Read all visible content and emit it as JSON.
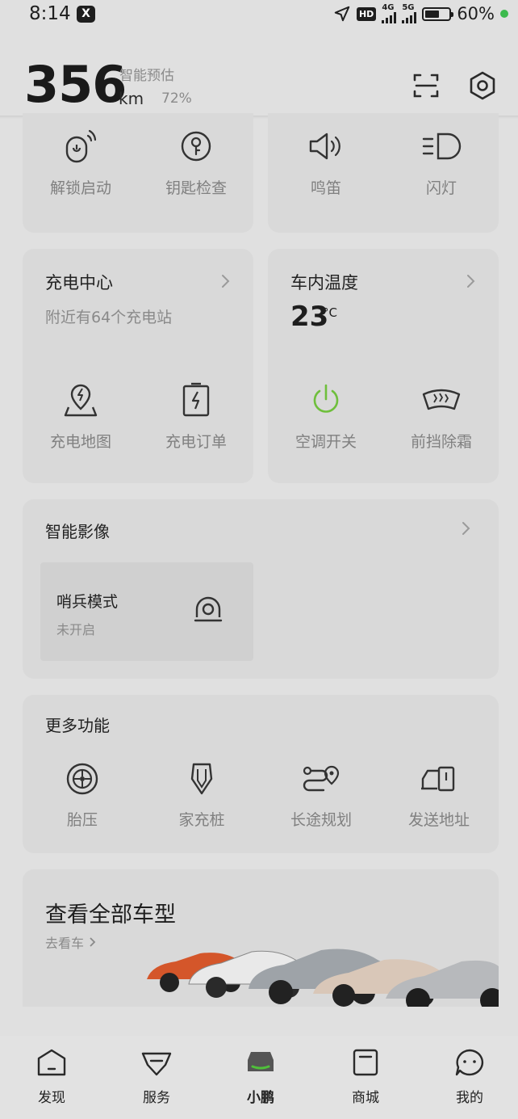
{
  "status_bar": {
    "time": "8:14",
    "app_icon": "X",
    "net_badge": "HD",
    "sim1": "4G",
    "sim2": "5G",
    "battery_level": 0.6,
    "battery_text": "60%"
  },
  "header": {
    "range_value": "356",
    "range_unit": "km",
    "estimate_label": "智能预估",
    "battery_percent": "72%",
    "icons": [
      "scan-icon",
      "settings-hex-icon"
    ]
  },
  "quick_controls": {
    "left": [
      {
        "label": "解锁启动",
        "icon": "remote-unlock-icon"
      },
      {
        "label": "钥匙检查",
        "icon": "key-icon"
      }
    ],
    "right": [
      {
        "label": "鸣笛",
        "icon": "horn-icon"
      },
      {
        "label": "闪灯",
        "icon": "headlight-icon"
      }
    ]
  },
  "charging_center": {
    "title": "充电中心",
    "subtitle": "附近有64个充电站",
    "items": [
      {
        "label": "充电地图",
        "icon": "charging-map-icon"
      },
      {
        "label": "充电订单",
        "icon": "charging-order-icon"
      }
    ]
  },
  "cabin_temp": {
    "title": "车内温度",
    "value": "23",
    "unit": "°C",
    "items": [
      {
        "label": "空调开关",
        "icon": "power-icon"
      },
      {
        "label": "前挡除霜",
        "icon": "defrost-icon"
      }
    ],
    "accent": "#6fbf3c"
  },
  "smart_video": {
    "title": "智能影像",
    "sentry": {
      "title": "哨兵模式",
      "status": "未开启",
      "icon": "camera-icon"
    }
  },
  "more_functions": {
    "title": "更多功能",
    "items": [
      {
        "label": "胎压",
        "icon": "tire-icon"
      },
      {
        "label": "家充桩",
        "icon": "home-charger-icon"
      },
      {
        "label": "长途规划",
        "icon": "route-icon"
      },
      {
        "label": "发送地址",
        "icon": "send-address-icon"
      }
    ]
  },
  "models_promo": {
    "title": "查看全部车型",
    "link": "去看车"
  },
  "bottom_nav": {
    "items": [
      {
        "label": "发现",
        "icon": "discover-icon"
      },
      {
        "label": "服务",
        "icon": "service-icon"
      },
      {
        "label": "小鹏",
        "icon": "car-icon"
      },
      {
        "label": "商城",
        "icon": "mall-icon"
      },
      {
        "label": "我的",
        "icon": "profile-icon"
      }
    ],
    "active_index": 2,
    "active_accent": "#4fbf3a"
  }
}
